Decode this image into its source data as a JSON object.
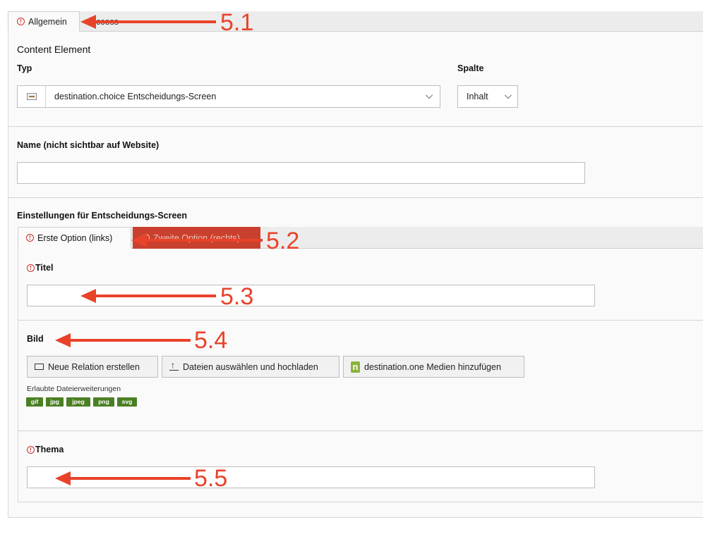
{
  "tabs": {
    "active_label": "Allgemein",
    "partial_label": "ccess"
  },
  "content_element": {
    "heading": "Content Element",
    "typ_label": "Typ",
    "typ_value": "destination.choice Entscheidungs-Screen",
    "spalte_label": "Spalte",
    "spalte_value": "Inhalt",
    "name_label": "Name (nicht sichtbar auf Website)",
    "name_value": ""
  },
  "settings": {
    "heading": "Einstellungen für Entscheidungs-Screen",
    "tab_first": "Erste Option (links)",
    "tab_second": "Zweite Option (rechts)",
    "titel_label": "Titel",
    "titel_value": "",
    "bild_label": "Bild",
    "buttons": {
      "new_relation": "Neue Relation erstellen",
      "upload": "Dateien auswählen und hochladen",
      "media": "destination.one Medien hinzufügen"
    },
    "allowed_label": "Erlaubte Dateierweiterungen",
    "extensions": [
      "gif",
      "jpg",
      "jpeg",
      "png",
      "svg"
    ],
    "thema_label": "Thema",
    "thema_value": ""
  },
  "annotations": {
    "a1": "5.1",
    "a2": "5.2",
    "a3": "5.3",
    "a4": "5.4",
    "a5": "5.5",
    "color": "#e8432a"
  },
  "colors": {
    "error_tab": "#c9412e",
    "extension_badge": "#4b7f23",
    "warning": "#c9302c"
  }
}
